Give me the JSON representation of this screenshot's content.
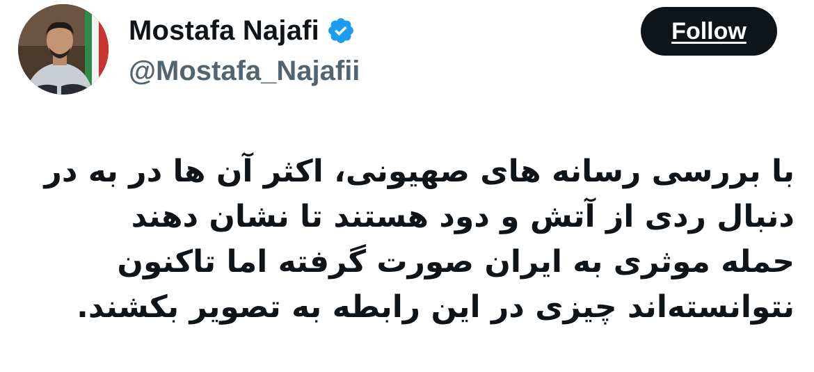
{
  "author": {
    "display_name": "Mostafa Najafi",
    "handle": "@Mostafa_Najafii",
    "verified": true,
    "verified_icon": "verified-badge-icon",
    "avatar": "profile-photo"
  },
  "follow_button": {
    "label": "Follow"
  },
  "tweet": {
    "lines": [
      "با بررسی رسانه های صهیونی، اکثر آن ها در به در",
      "دنبال ردی از آتش و دود هستند تا نشان دهند",
      "حمله موثری به ایران صورت گرفته اما تاکنون",
      "نتوانسته‌اند چیزی در این رابطه به تصویر بکشند."
    ]
  },
  "colors": {
    "text": "#0f1419",
    "secondary": "#536471",
    "verified_blue": "#1d9bf0",
    "button_bg": "#0f1419",
    "button_text": "#ffffff"
  }
}
